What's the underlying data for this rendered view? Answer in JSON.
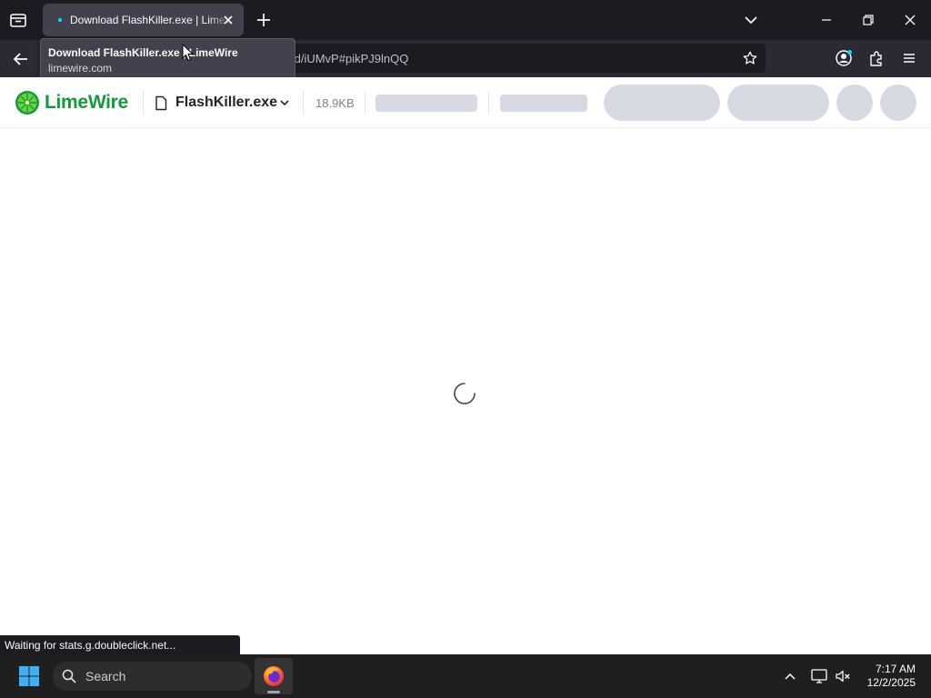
{
  "browser": {
    "tab": {
      "title": "Download FlashKiller.exe | LimeWire"
    },
    "url": "/d/iUMvP#pikPJ9lnQQ",
    "tooltip": {
      "title": "Download FlashKiller.exe | LimeWire",
      "domain": "limewire.com"
    },
    "status": "Waiting for stats.g.doubleclick.net..."
  },
  "page": {
    "brand": "LimeWire",
    "brand_color": "#129a3e",
    "file_name": "FlashKiller.exe",
    "file_size": "18.9KB",
    "loading": true
  },
  "taskbar": {
    "search_label": "Search",
    "time": "7:17 AM",
    "date": "12/2/2025",
    "pinned": [
      "firefox-icon"
    ]
  }
}
